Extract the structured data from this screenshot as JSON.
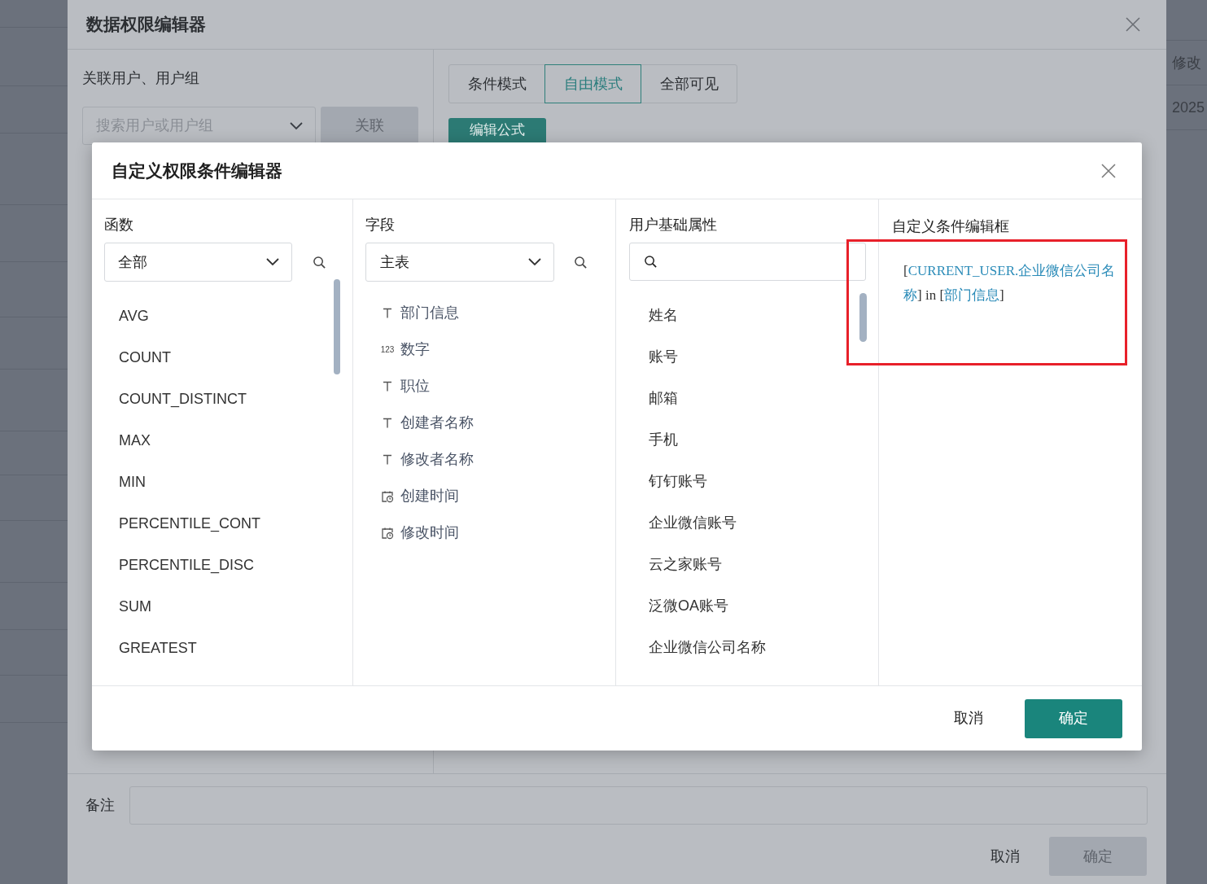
{
  "background": {
    "column_header": "修改",
    "cell": "2025"
  },
  "dialog": {
    "title": "数据权限编辑器",
    "link_label": "关联用户、用户组",
    "search": {
      "placeholder": "搜索用户或用户组"
    },
    "link_button": {
      "label": "关联",
      "disabled": true
    },
    "modes": [
      {
        "label": "条件模式",
        "selected": false
      },
      {
        "label": "自由模式",
        "selected": true
      },
      {
        "label": "全部可见",
        "selected": false
      }
    ],
    "formula_button": "编辑公式",
    "note": {
      "label": "备注"
    },
    "buttons": [
      {
        "label": "取消",
        "kind": "text",
        "disabled": false
      },
      {
        "label": "确定",
        "kind": "primary",
        "disabled": true
      }
    ]
  },
  "editor": {
    "title": "自定义权限条件编辑器",
    "functions": {
      "heading": "函数",
      "filter": "全部",
      "items": [
        "AVG",
        "COUNT",
        "COUNT_DISTINCT",
        "MAX",
        "MIN",
        "PERCENTILE_CONT",
        "PERCENTILE_DISC",
        "SUM",
        "GREATEST"
      ]
    },
    "fields": {
      "heading": "字段",
      "table": "主表",
      "items": [
        {
          "label": "部门信息",
          "kind": "text"
        },
        {
          "label": "数字",
          "kind": "number",
          "type_label": "123"
        },
        {
          "label": "职位",
          "kind": "text"
        },
        {
          "label": "创建者名称",
          "kind": "text"
        },
        {
          "label": "修改者名称",
          "kind": "text"
        },
        {
          "label": "创建时间",
          "kind": "datetime"
        },
        {
          "label": "修改时间",
          "kind": "datetime"
        }
      ]
    },
    "user_attributes": {
      "heading": "用户基础属性",
      "items": [
        "姓名",
        "账号",
        "邮箱",
        "手机",
        "钉钉账号",
        "企业微信账号",
        "云之家账号",
        "泛微OA账号",
        "企业微信公司名称"
      ]
    },
    "condition": {
      "heading": "自定义条件编辑框",
      "tokens": [
        {
          "text": "[",
          "kind": "plain"
        },
        {
          "text": "CURRENT_USER.企业微信公司名称",
          "kind": "ref"
        },
        {
          "text": "] in [",
          "kind": "plain"
        },
        {
          "text": "部门信息",
          "kind": "ref"
        },
        {
          "text": "]",
          "kind": "plain"
        }
      ]
    },
    "buttons": [
      {
        "label": "取消",
        "kind": "text"
      },
      {
        "label": "确定",
        "kind": "primary"
      }
    ]
  }
}
